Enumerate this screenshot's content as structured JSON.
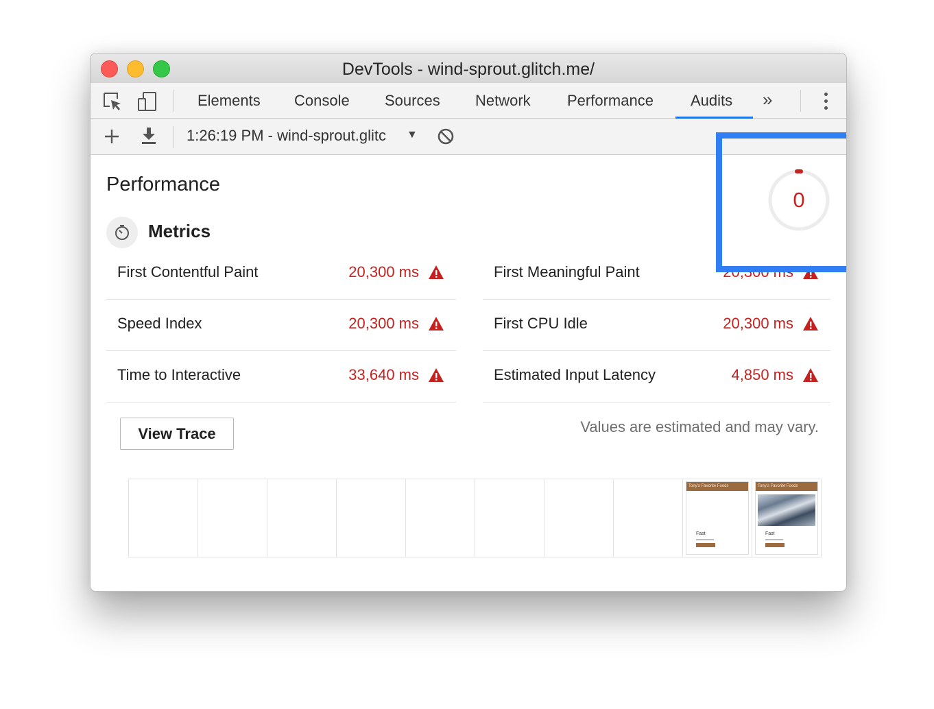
{
  "window": {
    "title": "DevTools - wind-sprout.glitch.me/"
  },
  "tabs": [
    {
      "label": "Elements"
    },
    {
      "label": "Console"
    },
    {
      "label": "Sources"
    },
    {
      "label": "Network"
    },
    {
      "label": "Performance"
    },
    {
      "label": "Audits",
      "active": true
    }
  ],
  "toolbar": {
    "report_select": "1:26:19 PM - wind-sprout.glitc",
    "more_tabs": "»"
  },
  "report": {
    "category_title": "Performance",
    "score": "0",
    "score_color": "#c5221f",
    "metrics_title": "Metrics",
    "metrics": [
      {
        "label": "First Contentful Paint",
        "value": "20,300 ms",
        "status": "fail"
      },
      {
        "label": "First Meaningful Paint",
        "value": "20,300 ms",
        "status": "fail"
      },
      {
        "label": "Speed Index",
        "value": "20,300 ms",
        "status": "fail"
      },
      {
        "label": "First CPU Idle",
        "value": "20,300 ms",
        "status": "fail"
      },
      {
        "label": "Time to Interactive",
        "value": "33,640 ms",
        "status": "fail"
      },
      {
        "label": "Estimated Input Latency",
        "value": "4,850 ms",
        "status": "fail"
      }
    ],
    "view_trace_label": "View Trace",
    "disclaimer": "Values are estimated and may vary.",
    "filmstrip": {
      "frame_count": 10,
      "thumbnails": [
        {
          "header": "Tony's Favorite Foods",
          "caption": "Fast"
        },
        {
          "header": "Tony's Favorite Foods",
          "caption": "Fast"
        }
      ]
    }
  },
  "colors": {
    "fail": "#c5221f",
    "accent": "#1a73e8",
    "highlight": "#2f7ef3"
  }
}
